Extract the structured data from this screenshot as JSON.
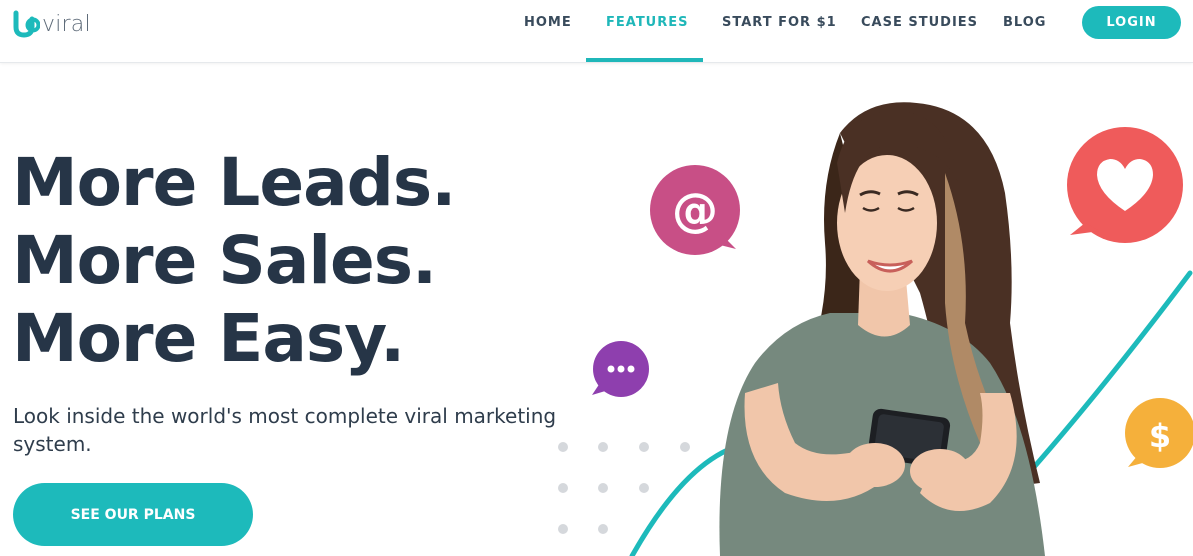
{
  "brand": {
    "logo_text": "viral",
    "logo_mark": "up-logo-icon",
    "accent": "#1dbabb"
  },
  "nav": {
    "items": [
      {
        "label": "HOME",
        "active": false
      },
      {
        "label": "FEATURES",
        "active": true
      },
      {
        "label": "START FOR $1",
        "active": false
      },
      {
        "label": "CASE STUDIES",
        "active": false
      },
      {
        "label": "BLOG",
        "active": false
      }
    ],
    "login_label": "LOGIN"
  },
  "hero": {
    "headline": [
      "More Leads.",
      "More Sales.",
      "More Easy."
    ],
    "subtitle": "Look inside the world's most complete viral marketing system.",
    "cta_label": "SEE OUR PLANS",
    "bubbles": [
      {
        "icon": "at-sign-icon",
        "color": "#c84f86"
      },
      {
        "icon": "heart-icon",
        "color": "#ef5b5b"
      },
      {
        "icon": "ellipsis-icon",
        "color": "#8e3fae"
      },
      {
        "icon": "dollar-icon",
        "color": "#f5b03b"
      }
    ]
  },
  "colors": {
    "heading": "#263547",
    "nav_text": "#394b5c",
    "active": "#1fb7b9"
  }
}
